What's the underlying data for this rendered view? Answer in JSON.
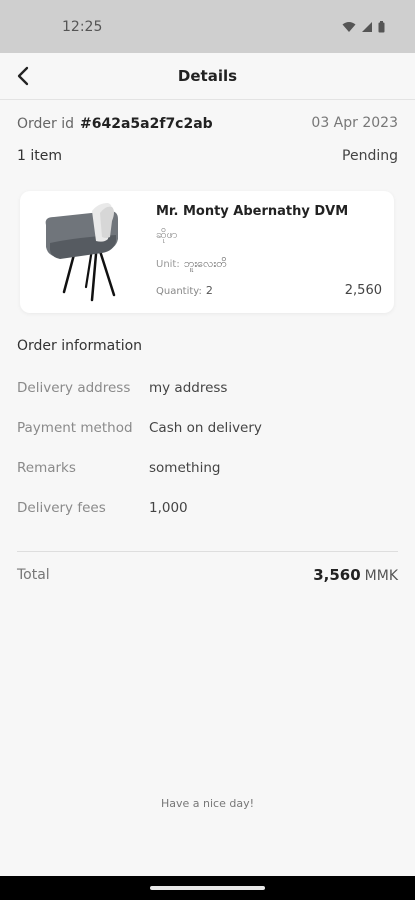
{
  "status_bar": {
    "time": "12:25"
  },
  "header": {
    "title": "Details"
  },
  "order": {
    "id_label": "Order id",
    "id": "#642a5a2f7c2ab",
    "date": "03 Apr 2023",
    "item_count": "1 item",
    "status": "Pending"
  },
  "product": {
    "name": "Mr. Monty Abernathy DVM",
    "subtitle": "ဆိုဖာ",
    "unit_label": "Unit:",
    "unit_value": "ဘူးလေးတိ",
    "quantity_label": "Quantity:",
    "quantity": "2",
    "price": "2,560",
    "image_icon": "chair-image"
  },
  "order_information": {
    "title": "Order information",
    "rows": [
      {
        "label": "Delivery address",
        "value": "my address"
      },
      {
        "label": "Payment method",
        "value": "Cash on delivery"
      },
      {
        "label": "Remarks",
        "value": "something"
      },
      {
        "label": "Delivery fees",
        "value": "1,000"
      }
    ]
  },
  "total": {
    "label": "Total",
    "amount": "3,560",
    "currency": "MMK"
  },
  "footer": {
    "note": "Have a nice day!"
  }
}
